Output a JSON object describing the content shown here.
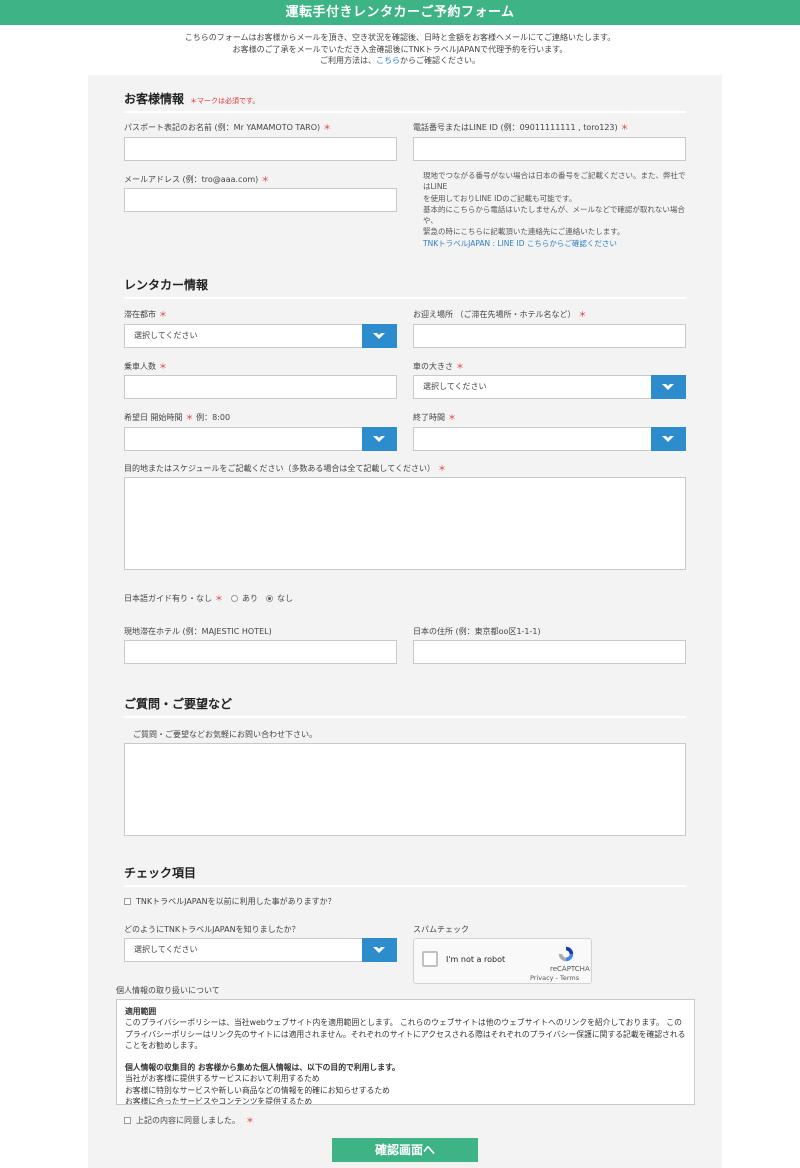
{
  "header": {
    "title": "運転手付きレンタカーご予約フォーム"
  },
  "intro": {
    "line1": "こちらのフォームはお客様からメールを頂き、空き状況を確認後、日時と金額をお客様へメールにてご連絡いたします。",
    "line2": "お客様のご了承をメールでいただき入金確認後にTNKトラベルJAPANで代理予約を行います。",
    "line3_prefix": "ご利用方法は、",
    "line3_link": "こちら",
    "line3_suffix": "からご確認ください。"
  },
  "customer": {
    "title": "お客様情報",
    "required_note": "＊マークは必須です。",
    "name_label": "パスポート表記のお名前 (例：Mr YAMAMOTO TARO)",
    "phone_label": "電話番号またはLINE ID (例：09011111111 , toro123)",
    "email_label": "メールアドレス (例：tro@aaa.com)",
    "help_lines": [
      "現地でつながる番号がない場合は日本の番号をご記載ください。また、弊社ではLINE",
      "を使用しておりLINE IDのご記載も可能です。",
      "基本的にこちらから電話はいたしませんが、メールなどで確認が取れない場合や、",
      "緊急の時にこちらに記載頂いた連絡先にご連絡いたします。"
    ],
    "help_link": "TNKトラベルJAPAN : LINE ID こちらからご確認ください"
  },
  "rental": {
    "title": "レンタカー情報",
    "city_label": "滞在都市",
    "city_value": "選択してください",
    "pickup_label": "お迎え場所 （ご滞在先場所・ホテル名など）",
    "passengers_label": "乗車人数",
    "car_size_label": "車の大きさ",
    "car_size_value": "選択してください",
    "start_label": "希望日 開始時間",
    "start_example": "例：8:00",
    "end_label": "終了時間",
    "schedule_label": "目的地またはスケジュールをご記載ください（多数ある場合は全て記載してください）",
    "guide_label": "日本語ガイド有り・なし",
    "guide_yes": "あり",
    "guide_no": "なし",
    "hotel_label": "現地滞在ホテル (例：MAJESTIC HOTEL)",
    "address_label": "日本の住所 (例：東京都oo区1-1-1)"
  },
  "questions": {
    "title": "ご質問・ご要望など",
    "label": "ご質問・ご要望などお気軽にお問い合わせ下さい。"
  },
  "checks": {
    "title": "チェック項目",
    "used_before": "TNKトラベルJAPANを以前に利用した事がありますか？",
    "how_known_label": "どのようにTNKトラベルJAPANを知りましたか？",
    "how_known_value": "選択してください",
    "spam_label": "スパムチェック",
    "captcha_text": "I'm not a robot",
    "captcha_brand": "reCAPTCHA",
    "captcha_terms": "Privacy - Terms"
  },
  "policy": {
    "label": "個人情報の取り扱いについて",
    "heading1": "適用範囲",
    "para1": "このプライバシーポリシーは、当社webウェブサイト内を適用範囲とします。 これらのウェブサイトは他のウェブサイトへのリンクを紹介しております。 このプライバシーポリシーはリンク先のサイトには適用されません。それぞれのサイトにアクセスされる際はそれぞれのプライバシー保護に関する記載を確認されることをお勧めします。",
    "heading2": "個人情報の収集目的 お客様から集めた個人情報は、以下の目的で利用します。",
    "item1": "当社がお客様に提供するサービスにおいて利用するため",
    "item2": "お客様に特別なサービスや新しい商品などの情報を的確にお知らせするため",
    "item3": "お客様に合ったサービスやコンテンツを提供するため",
    "agree": "上記の内容に同意しました。"
  },
  "submit": {
    "label": "確認画面へ"
  },
  "required_mark": "＊",
  "colors": {
    "brand_green": "#3db386",
    "select_blue": "#2d8dcc",
    "required_red": "#e0302f",
    "link_blue": "#2f7fc4"
  }
}
